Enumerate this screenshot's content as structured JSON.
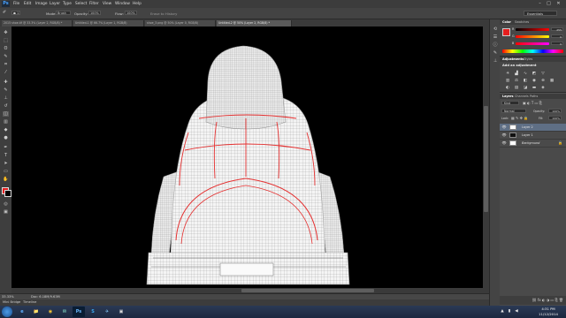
{
  "menubar": {
    "logo": "Ps",
    "items": [
      "File",
      "Edit",
      "Image",
      "Layer",
      "Type",
      "Select",
      "Filter",
      "View",
      "Window",
      "Help"
    ],
    "window_controls": [
      "–",
      "□",
      "✕"
    ]
  },
  "options": {
    "mode_label": "Mode:",
    "mode_value": "Brush",
    "opacity_label": "Opacity:",
    "opacity_value": "100%",
    "flow_label": "Flow:",
    "flow_value": "100%",
    "erase_to_history": "Erase to History",
    "workspace": "Essentials"
  },
  "tabs": [
    {
      "label": "2015 shoe.tif @ 33.3% (Layer 2, RGB/8) *"
    },
    {
      "label": "Untitled-1 @ 66.7% (Layer 1, RGB/8)"
    },
    {
      "label": "shoe_3.png @ 50% (Layer 0, RGB/8)"
    },
    {
      "label": "Untitled-2 @ 50% (Layer 2, RGB/8) *"
    }
  ],
  "status": {
    "zoom": "33.33%",
    "doc": "Doc: 6.18M/9.63M"
  },
  "bottom_tabs": [
    "Mini Bridge",
    "Timeline"
  ],
  "color_panel": {
    "tabs": [
      "Color",
      "Swatches"
    ],
    "r_label": "R",
    "r_value": "255",
    "g_label": "G",
    "g_value": "0",
    "b_label": "B",
    "b_value": "0"
  },
  "adjustments_panel": {
    "tabs": [
      "Adjustments",
      "Styles"
    ],
    "title": "Add an adjustment"
  },
  "layers_panel": {
    "tabs": [
      "Layers",
      "Channels",
      "Paths"
    ],
    "kind_label": "Kind",
    "blend_mode": "Normal",
    "opacity_label": "Opacity:",
    "opacity_value": "100%",
    "lock_label": "Lock:",
    "fill_label": "Fill:",
    "fill_value": "100%",
    "layers": [
      {
        "name": "Layer 2",
        "selected": true
      },
      {
        "name": "Layer 1",
        "selected": false
      },
      {
        "name": "Background",
        "selected": false
      }
    ]
  },
  "taskbar": {
    "apps": [
      "e",
      "📁",
      "◉",
      "✉",
      "Ps",
      "S",
      "✈",
      "▣"
    ],
    "time": "4:31 PM",
    "date": "11/12/2014"
  },
  "colors": {
    "foreground": "#e41e1e",
    "background": "#000000",
    "wireframe": "#e8e8e8",
    "seam": "#e53030"
  }
}
